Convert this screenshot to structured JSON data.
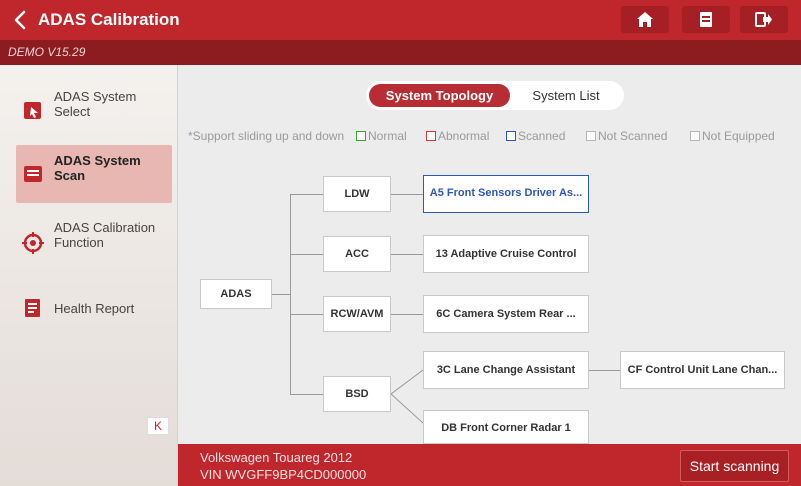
{
  "header": {
    "title": "ADAS Calibration",
    "version": "DEMO V15.29"
  },
  "sidebar": {
    "items": [
      {
        "label": "ADAS System Select",
        "icon": "select-system-icon"
      },
      {
        "label": "ADAS System Scan",
        "icon": "system-scan-icon",
        "active": true
      },
      {
        "label": "ADAS Calibration Function",
        "icon": "calibration-target-icon"
      },
      {
        "label": "Health Report",
        "icon": "report-icon"
      }
    ],
    "collapse_label": "K"
  },
  "view_toggle": {
    "active": "System Topology",
    "inactive": "System List"
  },
  "legend": {
    "note": "*Support sliding up and down",
    "items": [
      {
        "label": "Normal",
        "color": "#3aa43a"
      },
      {
        "label": "Abnormal",
        "color": "#d23b3b"
      },
      {
        "label": "Scanned",
        "color": "#2d57b8"
      },
      {
        "label": "Not Scanned",
        "color": "#b5b5b5"
      },
      {
        "label": "Not Equipped",
        "color": "#b5b5b5"
      }
    ]
  },
  "topology": {
    "root": "ADAS",
    "groups": [
      {
        "label": "LDW",
        "systems": [
          "A5 Front Sensors Driver As..."
        ]
      },
      {
        "label": "ACC",
        "systems": [
          "13 Adaptive Cruise Control"
        ]
      },
      {
        "label": "RCW/AVM",
        "systems": [
          "6C Camera System Rear ..."
        ]
      },
      {
        "label": "BSD",
        "systems": [
          "3C Lane Change Assistant",
          "DB Front Corner Radar 1"
        ],
        "child": "CF Control Unit Lane Chan..."
      }
    ]
  },
  "vehicle": {
    "model": "Volkswagen Touareg 2012",
    "vin": "VIN WVGFF9BP4CD000000"
  },
  "actions": {
    "start_label": "Start scanning"
  },
  "colors": {
    "brand_red": "#c0272d",
    "selected_blue": "#2d57b8"
  }
}
